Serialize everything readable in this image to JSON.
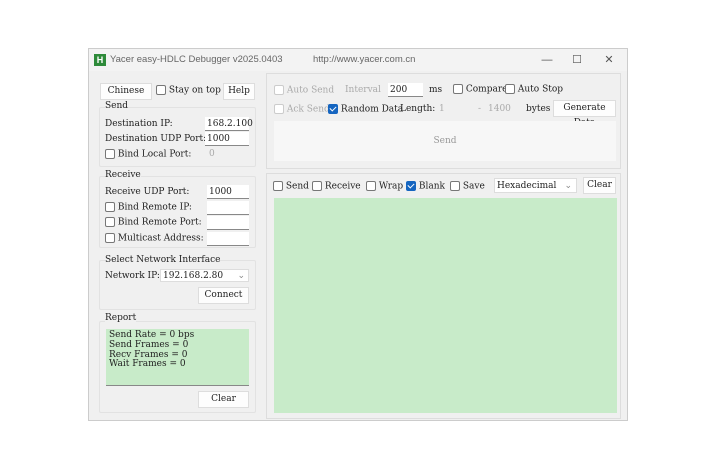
{
  "window": {
    "title": "Yacer easy-HDLC Debugger v2025.0403",
    "url": "http://www.yacer.com.cn",
    "logo": "H",
    "minimize": "—",
    "maximize": "☐",
    "close": "✕"
  },
  "top": {
    "chinese": "Chinese",
    "stay_on_top": "Stay on top",
    "help": "Help"
  },
  "send": {
    "title": "Send",
    "dest_ip_label": "Destination IP:",
    "dest_ip": "168.2.100",
    "dest_port_label": "Destination UDP Port:",
    "dest_port": "1000",
    "bind_local_label": "Bind Local Port:",
    "bind_local_value": "0"
  },
  "receive": {
    "title": "Receive",
    "port_label": "Receive UDP Port:",
    "port": "1000",
    "bind_ip_label": "Bind Remote IP:",
    "bind_port_label": "Bind Remote Port:",
    "multicast_label": "Multicast Address:"
  },
  "network": {
    "title": "Select Network Interface",
    "ip_label": "Network IP:",
    "ip": "192.168.2.80",
    "connect": "Connect"
  },
  "report": {
    "title": "Report",
    "lines": [
      "Send Rate = 0 bps",
      "Send Frames = 0",
      "Recv Frames = 0",
      "Wait Frames = 0"
    ],
    "clear": "Clear"
  },
  "sendctl": {
    "auto_send": "Auto Send",
    "interval_label": "Interval",
    "interval": "200",
    "ms": "ms",
    "compare": "Compare",
    "auto_stop": "Auto Stop",
    "ack_send": "Ack Send",
    "random_data": "Random Data",
    "length_label": "Length:",
    "len_min": "1",
    "dash": "-",
    "len_max": "1400",
    "bytes": "bytes",
    "generate": "Generate Data",
    "send_button": "Send"
  },
  "recvctl": {
    "send": "Send",
    "receive": "Receive",
    "wrap": "Wrap",
    "blank": "Blank",
    "save": "Save",
    "format": "Hexadecimal",
    "clear": "Clear"
  }
}
